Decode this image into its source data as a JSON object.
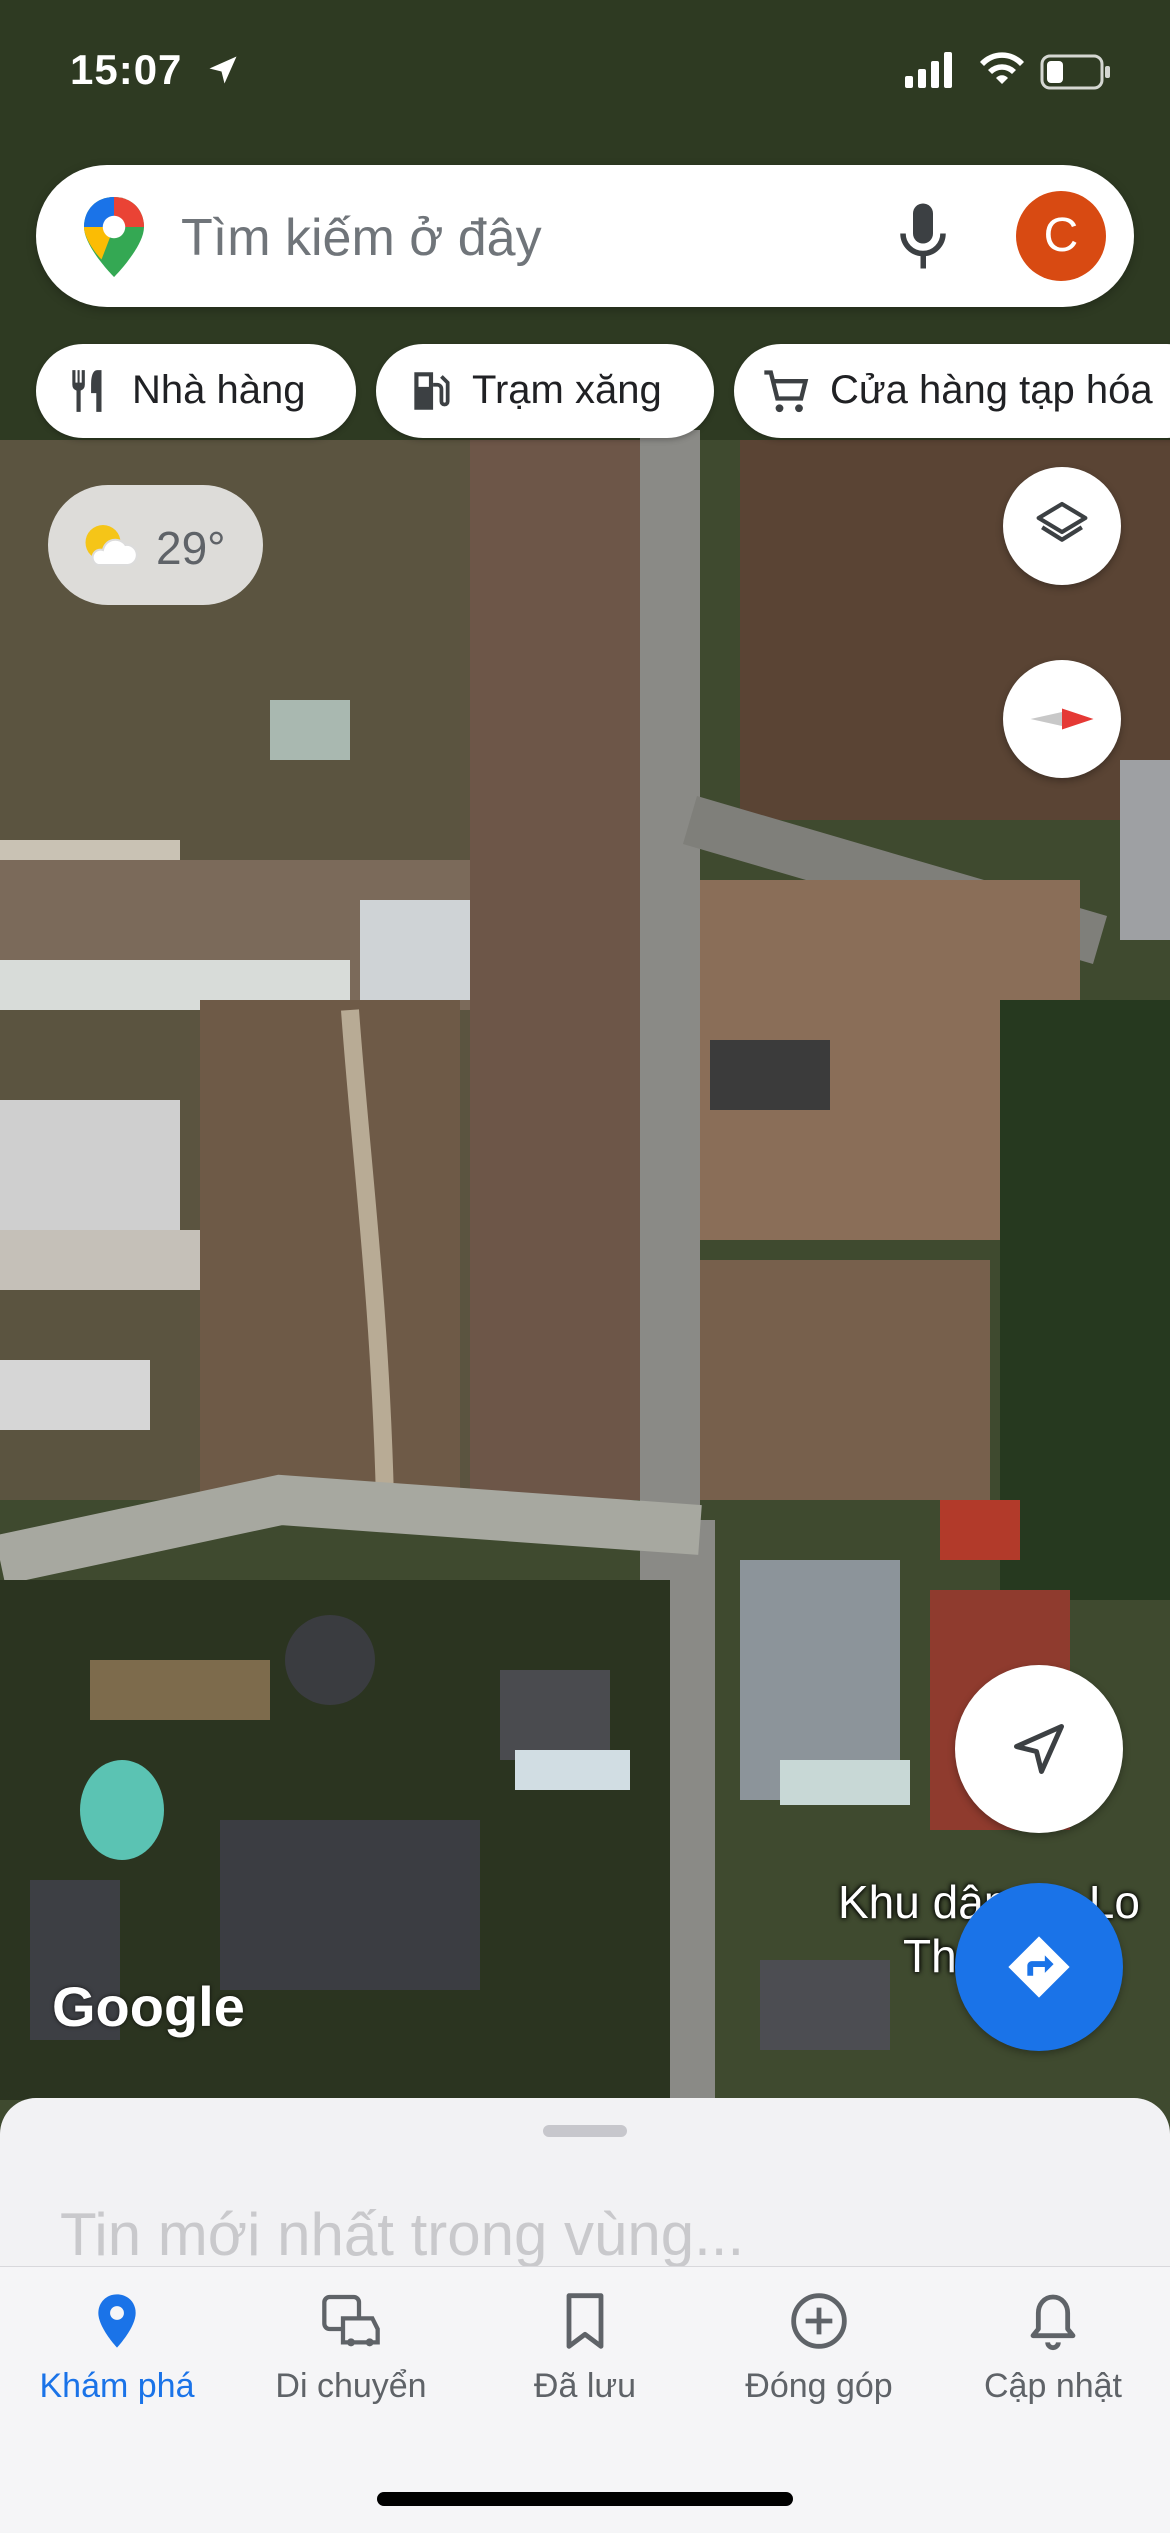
{
  "status_bar": {
    "time": "15:07"
  },
  "search": {
    "placeholder": "Tìm kiếm ở đây",
    "avatar_letter": "C"
  },
  "chips": [
    {
      "label": "Nhà hàng",
      "icon": "restaurant-icon"
    },
    {
      "label": "Trạm xăng",
      "icon": "gas-station-icon"
    },
    {
      "label": "Cửa hàng tạp hóa",
      "icon": "shopping-cart-icon"
    }
  ],
  "weather": {
    "temperature": "29°",
    "icon": "partly-sunny-icon"
  },
  "map": {
    "place_label_line1": "Khu dân cư Lo",
    "place_label_line2": "Th         na",
    "attribution": "Google"
  },
  "sheet": {
    "title": "Tin mới nhất trong vùng..."
  },
  "bottom_nav": [
    {
      "label": "Khám phá",
      "icon": "explore-pin-icon",
      "active": true
    },
    {
      "label": "Di chuyển",
      "icon": "commute-icon",
      "active": false
    },
    {
      "label": "Đã lưu",
      "icon": "bookmark-icon",
      "active": false
    },
    {
      "label": "Đóng góp",
      "icon": "add-circle-icon",
      "active": false
    },
    {
      "label": "Cập nhật",
      "icon": "bell-icon",
      "active": false
    }
  ],
  "colors": {
    "accent": "#1a73e8",
    "avatar_bg": "#d84a12",
    "compass_red": "#e53935"
  }
}
